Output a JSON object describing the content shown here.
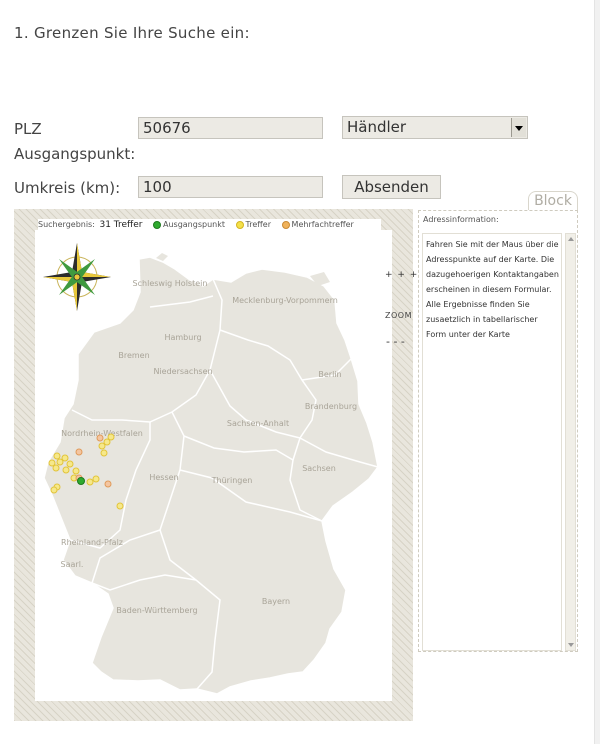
{
  "form": {
    "heading": "1. Grenzen Sie Ihre Suche ein:",
    "plz_label_line1": "PLZ",
    "plz_label_line2": "Ausgangspunkt:",
    "plz_value": "50676",
    "type_select_value": "Händler",
    "radius_label": "Umkreis (km):",
    "radius_value": "100",
    "submit_label": "Absenden"
  },
  "map": {
    "result_label": "Suchergebnis:",
    "result_count": "31 Treffer",
    "legend": [
      {
        "label": "Ausgangspunkt",
        "color": "#2faa2f"
      },
      {
        "label": "Treffer",
        "color": "#f4e04a"
      },
      {
        "label": "Mehrfachtreffer",
        "color": "#f0b25a"
      }
    ],
    "zoom_label": "ZOOM",
    "zoom_plus": "+ + + +",
    "zoom_minus": "- - -",
    "states": [
      "Schleswig Holstein",
      "Hamburg",
      "Mecklenburg-Vorpommern",
      "Bremen",
      "Niedersachsen",
      "Berlin",
      "Brandenburg",
      "Sachsen-Anhalt",
      "Nordrhein-Westfalen",
      "Sachsen",
      "Hessen",
      "Thüringen",
      "Rheinland-Pfalz",
      "Saarl.",
      "Baden-Württemberg",
      "Bayern"
    ]
  },
  "address_panel": {
    "tab_label": "Block",
    "title": "Adressinformation:",
    "text": "Fahren Sie mit der Maus über die Adresspunkte auf der Karte. Die dazugehoerigen Kontaktangaben erscheinen in diesem Formular. Alle Ergebnisse finden Sie zusaetzlich in tabellarischer Form unter der Karte"
  }
}
